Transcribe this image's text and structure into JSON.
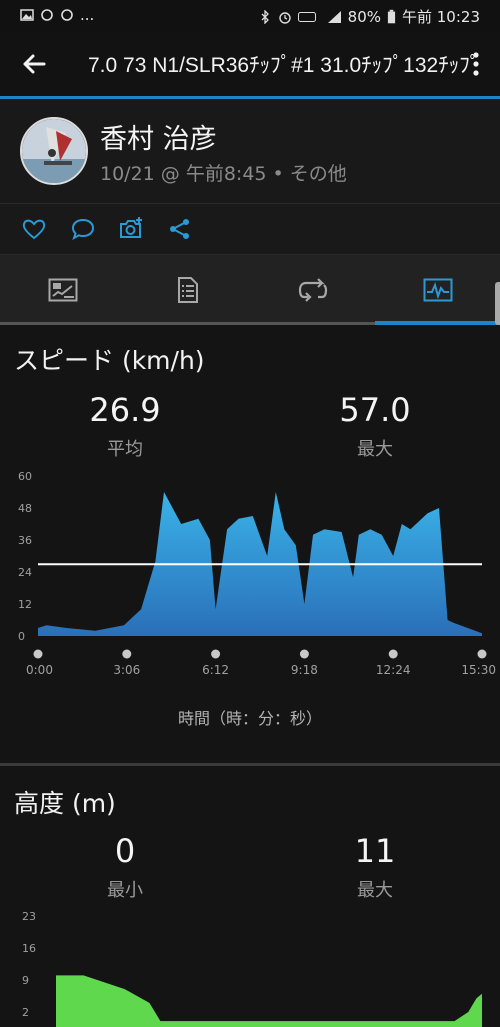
{
  "status_bar": {
    "left_icons": [
      "image-icon",
      "sync-icon",
      "sync-icon",
      "more-dots"
    ],
    "left_text": "...",
    "right_text": "80%",
    "time": "午前 10:23"
  },
  "app_bar": {
    "title": "7.0 73 N1/SLR36ﾁｯﾌﾟ#1 31.0ﾁｯﾌﾟ132ﾁｯﾌﾟ"
  },
  "profile": {
    "name": "香村 治彦",
    "meta": "10/21 @ 午前8:45 • その他"
  },
  "actions": [
    "heart-icon",
    "comment-icon",
    "add-photo-icon",
    "share-icon"
  ],
  "tabs": [
    {
      "icon": "summary-icon",
      "active": false
    },
    {
      "icon": "details-icon",
      "active": false
    },
    {
      "icon": "laps-icon",
      "active": false
    },
    {
      "icon": "charts-icon",
      "active": true
    }
  ],
  "speed": {
    "title": "スピード (km/h)",
    "avg_value": "26.9",
    "avg_label": "平均",
    "max_value": "57.0",
    "max_label": "最大",
    "x_axis_label": "時間（時：分：秒）"
  },
  "altitude": {
    "title": "高度 (m)",
    "min_value": "0",
    "min_label": "最小",
    "max_value": "11",
    "max_label": "最大"
  },
  "chart_data": [
    {
      "type": "area",
      "ylim": [
        0,
        60
      ],
      "y_ticks": [
        "0",
        "12",
        "24",
        "36",
        "48",
        "60"
      ],
      "x_ticks": [
        "0:00",
        "3:06",
        "6:12",
        "9:18",
        "12:24",
        "15:30"
      ],
      "xlim": [
        0,
        15.5
      ],
      "average_line": 26.9,
      "color": "#2aa3dc",
      "x": [
        0,
        0.3,
        1.0,
        2.0,
        3.0,
        3.6,
        4.1,
        4.4,
        5.0,
        5.6,
        6.0,
        6.2,
        6.6,
        7.0,
        7.5,
        8.0,
        8.3,
        8.6,
        9.0,
        9.3,
        9.6,
        10.0,
        10.6,
        11.0,
        11.2,
        11.6,
        12.0,
        12.4,
        12.7,
        13.0,
        13.6,
        14.0,
        14.3,
        14.5,
        15.0,
        15.5
      ],
      "y": [
        3,
        4,
        3,
        2,
        4,
        10,
        28,
        54,
        42,
        44,
        36,
        10,
        40,
        44,
        45,
        30,
        54,
        40,
        34,
        12,
        38,
        40,
        39,
        22,
        38,
        40,
        38,
        30,
        42,
        40,
        46,
        48,
        6,
        5,
        3,
        1
      ]
    },
    {
      "type": "area",
      "ylim": [
        0,
        23
      ],
      "y_ticks": [
        "2",
        "9",
        "16",
        "23"
      ],
      "color": "#5fd84d",
      "x": [
        0,
        1.0,
        2.5,
        3.4,
        3.8,
        4.0,
        14.5,
        15.0,
        15.3,
        15.5
      ],
      "y": [
        10,
        10,
        7,
        4,
        0,
        0,
        0,
        2,
        5,
        6
      ]
    }
  ]
}
